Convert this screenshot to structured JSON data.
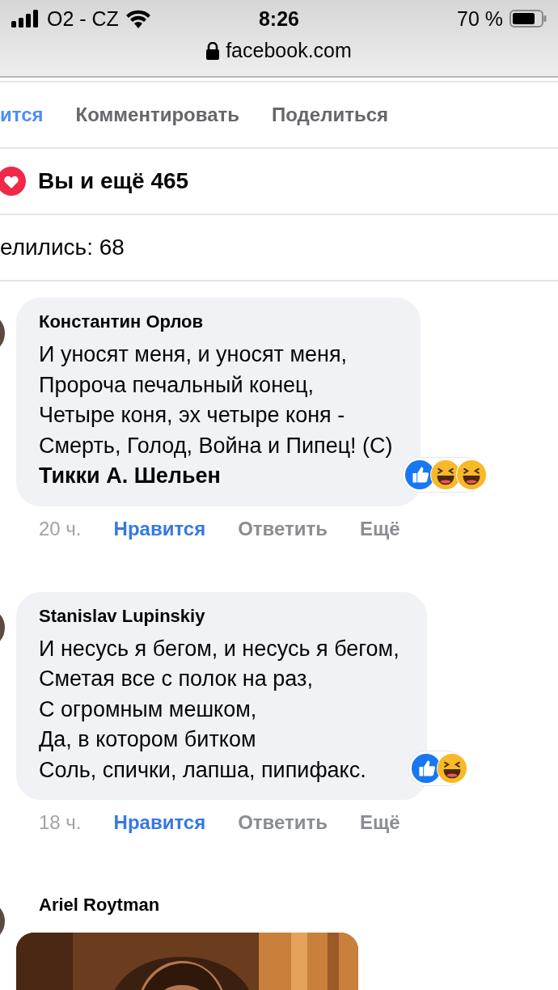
{
  "status_bar": {
    "carrier": "O2 - CZ",
    "time": "8:26",
    "battery": "70 %"
  },
  "address_bar": {
    "url": "facebook.com"
  },
  "post_actions": [
    {
      "label": "ится",
      "active": true
    },
    {
      "label": "Комментировать",
      "active": false
    },
    {
      "label": "Поделиться",
      "active": false
    }
  ],
  "reactions_summary": {
    "text": "Вы и ещё 465"
  },
  "shares": {
    "text": "елились: 68"
  },
  "comments": [
    {
      "author": "Константин Орлов",
      "text": "И уносят меня, и уносят меня,\nПророча печальный конец,\nЧетыре коня, эх четыре коня -\nСмерть, Голод, Война и Пипец! (С)\n**Тикки А. Шельен**",
      "time": "20 ч.",
      "actions": [
        {
          "label": "Нравится",
          "active": true
        },
        {
          "label": "Ответить",
          "active": false
        },
        {
          "label": "Ещё",
          "active": false
        }
      ],
      "reaction_icons": [
        {
          "kind": "like"
        },
        {
          "kind": "haha"
        },
        {
          "kind": "haha"
        }
      ]
    },
    {
      "author": "Stanislav Lupinskiy",
      "text": "И несусь я бегом, и несусь я бегом,\nСметая все с полок на раз,\nС огромным мешком,\nДа, в котором битком\nСоль, спички, лапша, пипифакс.",
      "time": "18 ч.",
      "actions": [
        {
          "label": "Нравится",
          "active": true
        },
        {
          "label": "Ответить",
          "active": false
        },
        {
          "label": "Ещё",
          "active": false
        }
      ],
      "reaction_icons": [
        {
          "kind": "like"
        },
        {
          "kind": "haha"
        }
      ]
    },
    {
      "author": "Ariel Roytman"
    }
  ]
}
